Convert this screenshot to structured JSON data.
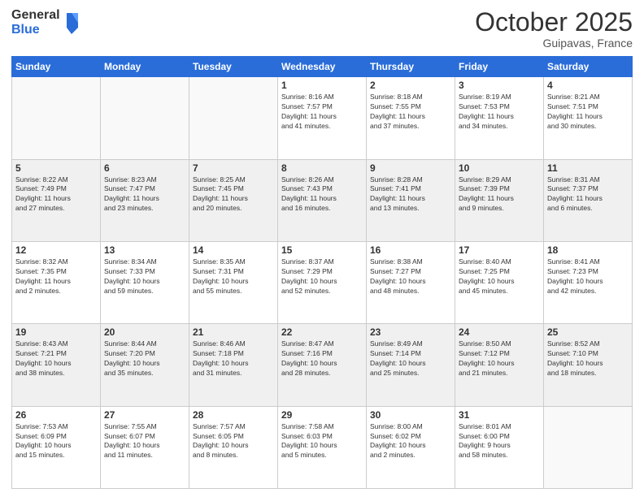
{
  "logo": {
    "general": "General",
    "blue": "Blue"
  },
  "header": {
    "month": "October 2025",
    "location": "Guipavas, France"
  },
  "days_of_week": [
    "Sunday",
    "Monday",
    "Tuesday",
    "Wednesday",
    "Thursday",
    "Friday",
    "Saturday"
  ],
  "weeks": [
    [
      {
        "day": "",
        "info": ""
      },
      {
        "day": "",
        "info": ""
      },
      {
        "day": "",
        "info": ""
      },
      {
        "day": "1",
        "info": "Sunrise: 8:16 AM\nSunset: 7:57 PM\nDaylight: 11 hours\nand 41 minutes."
      },
      {
        "day": "2",
        "info": "Sunrise: 8:18 AM\nSunset: 7:55 PM\nDaylight: 11 hours\nand 37 minutes."
      },
      {
        "day": "3",
        "info": "Sunrise: 8:19 AM\nSunset: 7:53 PM\nDaylight: 11 hours\nand 34 minutes."
      },
      {
        "day": "4",
        "info": "Sunrise: 8:21 AM\nSunset: 7:51 PM\nDaylight: 11 hours\nand 30 minutes."
      }
    ],
    [
      {
        "day": "5",
        "info": "Sunrise: 8:22 AM\nSunset: 7:49 PM\nDaylight: 11 hours\nand 27 minutes."
      },
      {
        "day": "6",
        "info": "Sunrise: 8:23 AM\nSunset: 7:47 PM\nDaylight: 11 hours\nand 23 minutes."
      },
      {
        "day": "7",
        "info": "Sunrise: 8:25 AM\nSunset: 7:45 PM\nDaylight: 11 hours\nand 20 minutes."
      },
      {
        "day": "8",
        "info": "Sunrise: 8:26 AM\nSunset: 7:43 PM\nDaylight: 11 hours\nand 16 minutes."
      },
      {
        "day": "9",
        "info": "Sunrise: 8:28 AM\nSunset: 7:41 PM\nDaylight: 11 hours\nand 13 minutes."
      },
      {
        "day": "10",
        "info": "Sunrise: 8:29 AM\nSunset: 7:39 PM\nDaylight: 11 hours\nand 9 minutes."
      },
      {
        "day": "11",
        "info": "Sunrise: 8:31 AM\nSunset: 7:37 PM\nDaylight: 11 hours\nand 6 minutes."
      }
    ],
    [
      {
        "day": "12",
        "info": "Sunrise: 8:32 AM\nSunset: 7:35 PM\nDaylight: 11 hours\nand 2 minutes."
      },
      {
        "day": "13",
        "info": "Sunrise: 8:34 AM\nSunset: 7:33 PM\nDaylight: 10 hours\nand 59 minutes."
      },
      {
        "day": "14",
        "info": "Sunrise: 8:35 AM\nSunset: 7:31 PM\nDaylight: 10 hours\nand 55 minutes."
      },
      {
        "day": "15",
        "info": "Sunrise: 8:37 AM\nSunset: 7:29 PM\nDaylight: 10 hours\nand 52 minutes."
      },
      {
        "day": "16",
        "info": "Sunrise: 8:38 AM\nSunset: 7:27 PM\nDaylight: 10 hours\nand 48 minutes."
      },
      {
        "day": "17",
        "info": "Sunrise: 8:40 AM\nSunset: 7:25 PM\nDaylight: 10 hours\nand 45 minutes."
      },
      {
        "day": "18",
        "info": "Sunrise: 8:41 AM\nSunset: 7:23 PM\nDaylight: 10 hours\nand 42 minutes."
      }
    ],
    [
      {
        "day": "19",
        "info": "Sunrise: 8:43 AM\nSunset: 7:21 PM\nDaylight: 10 hours\nand 38 minutes."
      },
      {
        "day": "20",
        "info": "Sunrise: 8:44 AM\nSunset: 7:20 PM\nDaylight: 10 hours\nand 35 minutes."
      },
      {
        "day": "21",
        "info": "Sunrise: 8:46 AM\nSunset: 7:18 PM\nDaylight: 10 hours\nand 31 minutes."
      },
      {
        "day": "22",
        "info": "Sunrise: 8:47 AM\nSunset: 7:16 PM\nDaylight: 10 hours\nand 28 minutes."
      },
      {
        "day": "23",
        "info": "Sunrise: 8:49 AM\nSunset: 7:14 PM\nDaylight: 10 hours\nand 25 minutes."
      },
      {
        "day": "24",
        "info": "Sunrise: 8:50 AM\nSunset: 7:12 PM\nDaylight: 10 hours\nand 21 minutes."
      },
      {
        "day": "25",
        "info": "Sunrise: 8:52 AM\nSunset: 7:10 PM\nDaylight: 10 hours\nand 18 minutes."
      }
    ],
    [
      {
        "day": "26",
        "info": "Sunrise: 7:53 AM\nSunset: 6:09 PM\nDaylight: 10 hours\nand 15 minutes."
      },
      {
        "day": "27",
        "info": "Sunrise: 7:55 AM\nSunset: 6:07 PM\nDaylight: 10 hours\nand 11 minutes."
      },
      {
        "day": "28",
        "info": "Sunrise: 7:57 AM\nSunset: 6:05 PM\nDaylight: 10 hours\nand 8 minutes."
      },
      {
        "day": "29",
        "info": "Sunrise: 7:58 AM\nSunset: 6:03 PM\nDaylight: 10 hours\nand 5 minutes."
      },
      {
        "day": "30",
        "info": "Sunrise: 8:00 AM\nSunset: 6:02 PM\nDaylight: 10 hours\nand 2 minutes."
      },
      {
        "day": "31",
        "info": "Sunrise: 8:01 AM\nSunset: 6:00 PM\nDaylight: 9 hours\nand 58 minutes."
      },
      {
        "day": "",
        "info": ""
      }
    ]
  ]
}
